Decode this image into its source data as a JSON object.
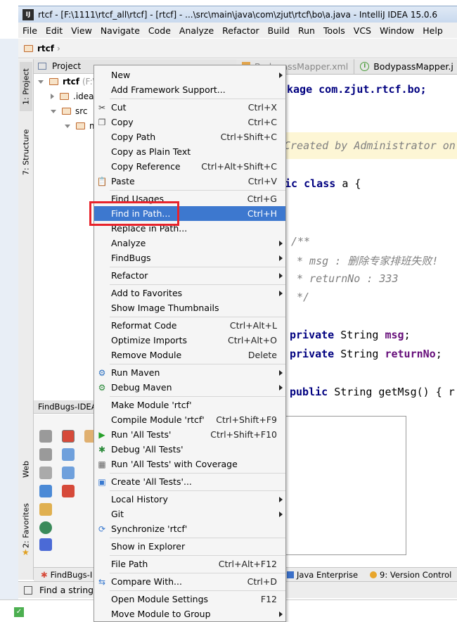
{
  "window": {
    "title": "rtcf - [F:\\1111\\rtcf_all\\rtcf] - [rtcf] - ...\\src\\main\\java\\com\\zjut\\rtcf\\bo\\a.java - IntelliJ IDEA 15.0.6",
    "app_icon": "IJ"
  },
  "menubar": [
    "File",
    "Edit",
    "View",
    "Navigate",
    "Code",
    "Analyze",
    "Refactor",
    "Build",
    "Run",
    "Tools",
    "VCS",
    "Window",
    "Help"
  ],
  "navbar": {
    "crumb": "rtcf"
  },
  "side_tabs": [
    "1: Project",
    "7: Structure",
    "Web",
    "2: Favorites"
  ],
  "project_panel": {
    "title": "Project",
    "tree": [
      {
        "label": "rtcf",
        "suffix": "(F:\\"
      },
      {
        "label": ".idea"
      },
      {
        "label": "src"
      },
      {
        "label": "m"
      }
    ]
  },
  "findbugs_panel": {
    "title": "FindBugs-IDEA"
  },
  "editor_tabs": [
    "BodypassMapper.xml",
    "BodypassMapper.j"
  ],
  "code": {
    "line1": "kage com.zjut.rtcf.bo;",
    "comment_line": "Created by Administrator on",
    "class_kw": "lic class",
    "class_name": "a {",
    "doc_open": "/**",
    "doc_msg": "* msg : 删除专家排班失败!",
    "doc_return": "* returnNo : 333",
    "doc_close": "*/",
    "field1_kw": "private",
    "field1_type": "String",
    "field1_name": "msg",
    "field2_kw": "private",
    "field2_type": "String",
    "field2_name": "returnNo",
    "method_kw": "public",
    "method_rest": "String getMsg() { r"
  },
  "bottom_tools": [
    "FindBugs-I",
    "Java Enterprise",
    "9: Version Control"
  ],
  "status": {
    "text": "Find a string"
  },
  "context_menu": [
    {
      "label": "New",
      "shortcut": "",
      "submenu": true,
      "icon": ""
    },
    {
      "label": "Add Framework Support...",
      "shortcut": "",
      "submenu": false,
      "icon": ""
    },
    {
      "sep": true
    },
    {
      "label": "Cut",
      "shortcut": "Ctrl+X",
      "submenu": false,
      "icon": "scissors-icon"
    },
    {
      "label": "Copy",
      "shortcut": "Ctrl+C",
      "submenu": false,
      "icon": "copy-icon"
    },
    {
      "label": "Copy Path",
      "shortcut": "Ctrl+Shift+C",
      "submenu": false,
      "icon": ""
    },
    {
      "label": "Copy as Plain Text",
      "shortcut": "",
      "submenu": false,
      "icon": ""
    },
    {
      "label": "Copy Reference",
      "shortcut": "Ctrl+Alt+Shift+C",
      "submenu": false,
      "icon": ""
    },
    {
      "label": "Paste",
      "shortcut": "Ctrl+V",
      "submenu": false,
      "icon": "paste-icon"
    },
    {
      "sep": true
    },
    {
      "label": "Find Usages",
      "shortcut": "Ctrl+G",
      "submenu": false,
      "icon": ""
    },
    {
      "label": "Find in Path...",
      "shortcut": "Ctrl+H",
      "submenu": false,
      "icon": "",
      "selected": true
    },
    {
      "label": "Replace in Path...",
      "shortcut": "",
      "submenu": false,
      "icon": ""
    },
    {
      "label": "Analyze",
      "shortcut": "",
      "submenu": true,
      "icon": ""
    },
    {
      "label": "FindBugs",
      "shortcut": "",
      "submenu": true,
      "icon": ""
    },
    {
      "sep": true
    },
    {
      "label": "Refactor",
      "shortcut": "",
      "submenu": true,
      "icon": ""
    },
    {
      "sep": true
    },
    {
      "label": "Add to Favorites",
      "shortcut": "",
      "submenu": true,
      "icon": ""
    },
    {
      "label": "Show Image Thumbnails",
      "shortcut": "",
      "submenu": false,
      "icon": ""
    },
    {
      "sep": true
    },
    {
      "label": "Reformat Code",
      "shortcut": "Ctrl+Alt+L",
      "submenu": false,
      "icon": ""
    },
    {
      "label": "Optimize Imports",
      "shortcut": "Ctrl+Alt+O",
      "submenu": false,
      "icon": ""
    },
    {
      "label": "Remove Module",
      "shortcut": "Delete",
      "submenu": false,
      "icon": ""
    },
    {
      "sep": true
    },
    {
      "label": "Run Maven",
      "shortcut": "",
      "submenu": true,
      "icon": "gear-icon"
    },
    {
      "label": "Debug Maven",
      "shortcut": "",
      "submenu": true,
      "icon": "debug-gear-icon"
    },
    {
      "sep": true
    },
    {
      "label": "Make Module 'rtcf'",
      "shortcut": "",
      "submenu": false,
      "icon": ""
    },
    {
      "label": "Compile Module 'rtcf'",
      "shortcut": "Ctrl+Shift+F9",
      "submenu": false,
      "icon": ""
    },
    {
      "label": "Run 'All Tests'",
      "shortcut": "Ctrl+Shift+F10",
      "submenu": false,
      "icon": "run-icon"
    },
    {
      "label": "Debug 'All Tests'",
      "shortcut": "",
      "submenu": false,
      "icon": "debug-icon"
    },
    {
      "label": "Run 'All Tests' with Coverage",
      "shortcut": "",
      "submenu": false,
      "icon": "coverage-icon"
    },
    {
      "sep": true
    },
    {
      "label": "Create 'All Tests'...",
      "shortcut": "",
      "submenu": false,
      "icon": "create-config-icon"
    },
    {
      "sep": true
    },
    {
      "label": "Local History",
      "shortcut": "",
      "submenu": true,
      "icon": ""
    },
    {
      "label": "Git",
      "shortcut": "",
      "submenu": true,
      "icon": ""
    },
    {
      "label": "Synchronize 'rtcf'",
      "shortcut": "",
      "submenu": false,
      "icon": "sync-icon"
    },
    {
      "sep": true
    },
    {
      "label": "Show in Explorer",
      "shortcut": "",
      "submenu": false,
      "icon": ""
    },
    {
      "sep": true
    },
    {
      "label": "File Path",
      "shortcut": "Ctrl+Alt+F12",
      "submenu": false,
      "icon": ""
    },
    {
      "sep": true
    },
    {
      "label": "Compare With...",
      "shortcut": "Ctrl+D",
      "submenu": false,
      "icon": "compare-icon"
    },
    {
      "sep": true
    },
    {
      "label": "Open Module Settings",
      "shortcut": "F12",
      "submenu": false,
      "icon": ""
    },
    {
      "label": "Move Module to Group",
      "shortcut": "",
      "submenu": true,
      "icon": ""
    }
  ],
  "colors": {
    "selection": "#3d78cf",
    "highlight_box": "#e8232b"
  }
}
